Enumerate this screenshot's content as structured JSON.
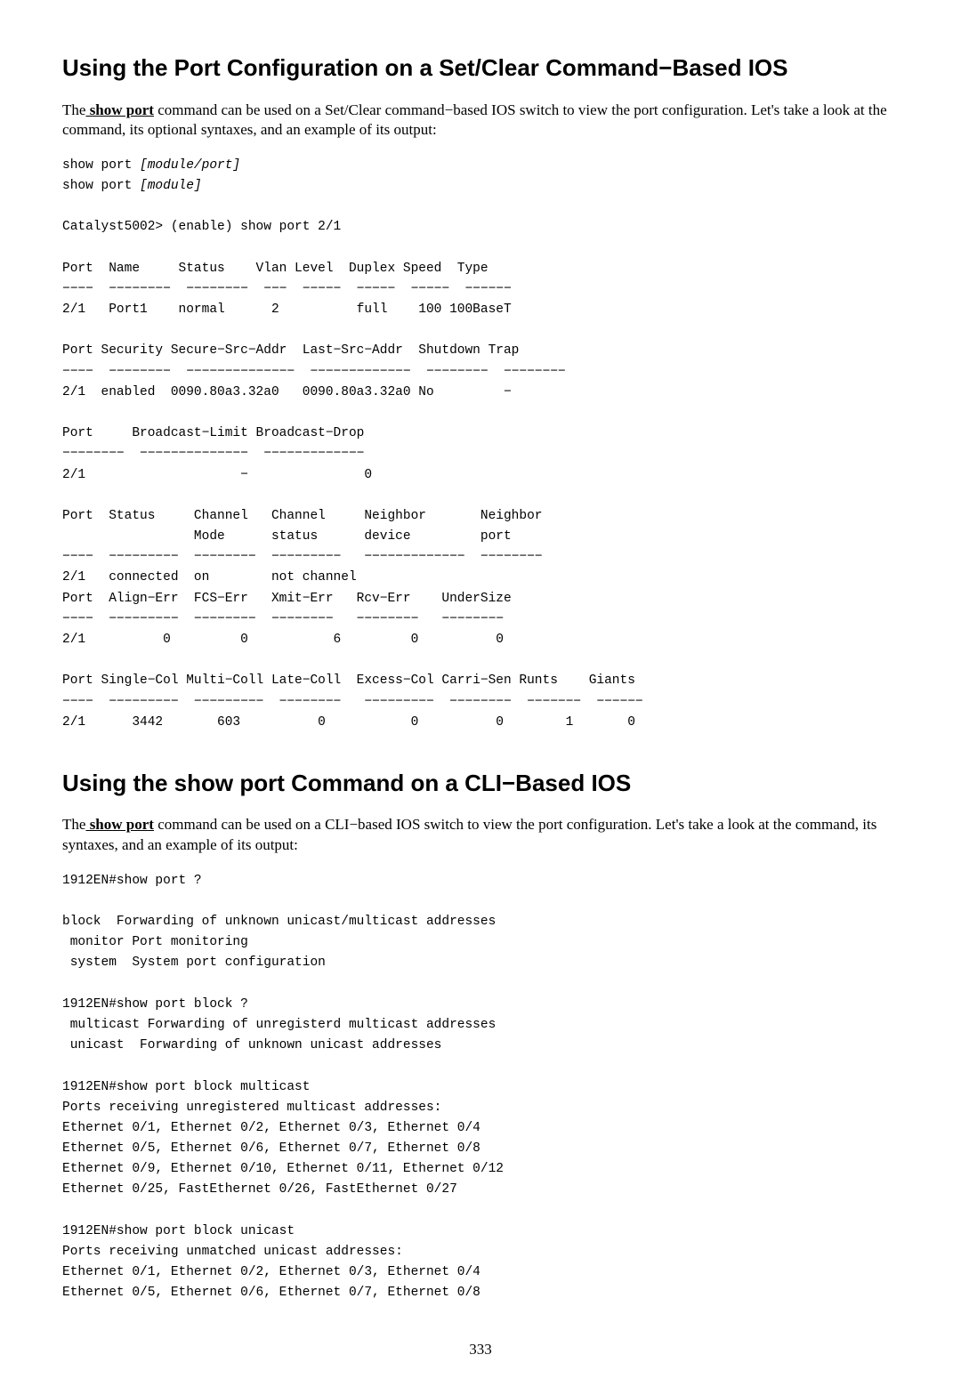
{
  "section1": {
    "heading": "Using the Port Configuration on a Set/Clear Command−Based IOS",
    "para_before": "The",
    "cmd": " show port",
    "para_after": " command can be used on a Set/Clear command−based IOS switch to view the port configuration. Let's take a look at the command, its optional syntaxes, and an example of its output:",
    "pre_a": "show port ",
    "pre_a_i": "[module/port]",
    "pre_b": "\nshow port ",
    "pre_b_i": "[module]",
    "pre_rest": "\n\nCatalyst5002> (enable) show port 2/1\n\nPort  Name     Status    Vlan Level  Duplex Speed  Type\n−−−−  −−−−−−−−  −−−−−−−−  −−−  −−−−−  −−−−−  −−−−−  −−−−−−\n2/1   Port1    normal      2          full    100 100BaseT\n\nPort Security Secure−Src−Addr  Last−Src−Addr  Shutdown Trap\n−−−−  −−−−−−−−  −−−−−−−−−−−−−−  −−−−−−−−−−−−−  −−−−−−−−  −−−−−−−−\n2/1  enabled  0090.80a3.32a0   0090.80a3.32a0 No         −\n\nPort     Broadcast−Limit Broadcast−Drop\n−−−−−−−−  −−−−−−−−−−−−−−  −−−−−−−−−−−−−\n2/1                    −               0\n\nPort  Status     Channel   Channel     Neighbor       Neighbor\n                 Mode      status      device         port\n−−−−  −−−−−−−−−  −−−−−−−−  −−−−−−−−−   −−−−−−−−−−−−−  −−−−−−−−\n2/1   connected  on        not channel\nPort  Align−Err  FCS−Err   Xmit−Err   Rcv−Err    UnderSize\n−−−−  −−−−−−−−−  −−−−−−−−  −−−−−−−−   −−−−−−−−   −−−−−−−−\n2/1          0         0           6         0          0\n\nPort Single−Col Multi−Coll Late−Coll  Excess−Col Carri−Sen Runts    Giants\n−−−−  −−−−−−−−−  −−−−−−−−−  −−−−−−−−   −−−−−−−−−  −−−−−−−−  −−−−−−−  −−−−−−\n2/1      3442       603          0           0          0        1       0"
  },
  "section2": {
    "heading": "Using the show port Command on a CLI−Based IOS",
    "para_before": "The",
    "cmd": " show port",
    "para_after": " command can be used on a CLI−based IOS switch to view the port configuration. Let's take a look at the command, its syntaxes, and an example of its output:",
    "pre": "1912EN#show port ?\n\nblock  Forwarding of unknown unicast/multicast addresses\n monitor Port monitoring\n system  System port configuration\n\n1912EN#show port block ?\n multicast Forwarding of unregisterd multicast addresses\n unicast  Forwarding of unknown unicast addresses\n\n1912EN#show port block multicast\nPorts receiving unregistered multicast addresses:\nEthernet 0/1, Ethernet 0/2, Ethernet 0/3, Ethernet 0/4\nEthernet 0/5, Ethernet 0/6, Ethernet 0/7, Ethernet 0/8\nEthernet 0/9, Ethernet 0/10, Ethernet 0/11, Ethernet 0/12\nEthernet 0/25, FastEthernet 0/26, FastEthernet 0/27\n\n1912EN#show port block unicast\nPorts receiving unmatched unicast addresses:\nEthernet 0/1, Ethernet 0/2, Ethernet 0/3, Ethernet 0/4\nEthernet 0/5, Ethernet 0/6, Ethernet 0/7, Ethernet 0/8"
  },
  "page_number": "333"
}
